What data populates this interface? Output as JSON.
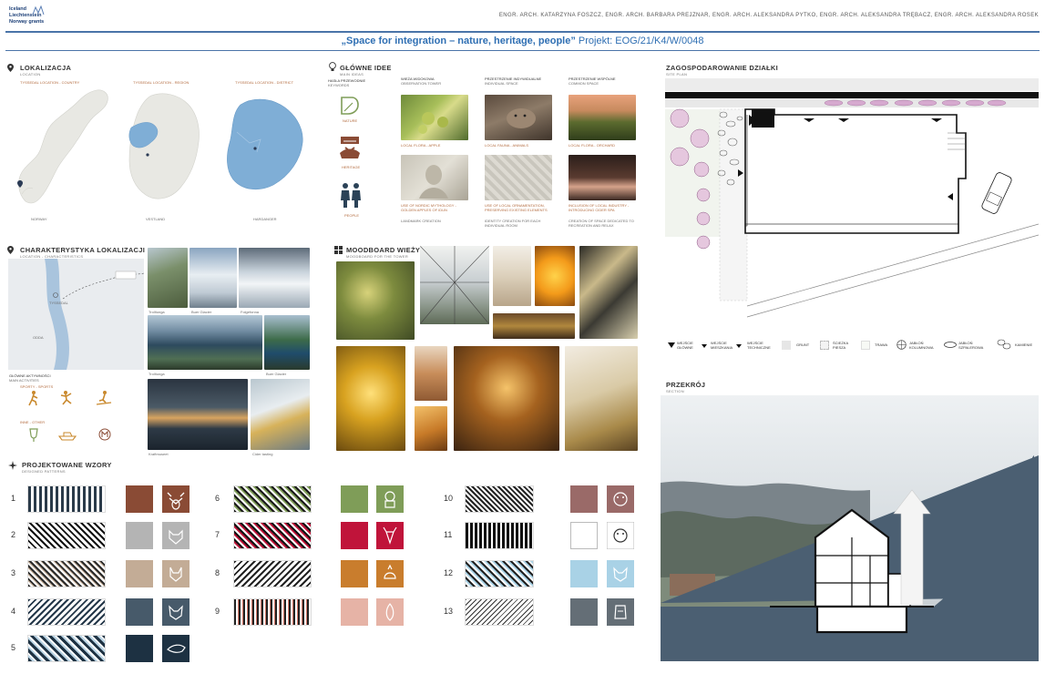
{
  "header": {
    "logo_lines": [
      "Iceland",
      "Liechtenstein",
      "Norway grants"
    ],
    "authors": "ENGR. ARCH. KATARZYNA FOSZCZ, ENGR. ARCH. BARBARA PREJZNAR, ENGR. ARCH. ALEKSANDRA PYTKO, ENGR. ARCH. ALEKSANDRA TRĘBACZ, ENGR. ARCH. ALEKSANDRA ROSEK",
    "title_quote": "„Space for integration – nature, heritage, people”",
    "title_project": " Projekt: EOG/21/K4/W/0048",
    "accent": "#2f6fb3",
    "rule_color": "#3f6fa8"
  },
  "location": {
    "title": "LOKALIZACJA",
    "subtitle": "LOCATION",
    "maps": [
      {
        "heading": "TYSSEDAL LOCATION - COUNTRY",
        "caption": "NORWAY"
      },
      {
        "heading": "TYSSEDAL LOCATION - REGION",
        "caption": "VESTLAND"
      },
      {
        "heading": "TYSSEDAL LOCATION - DISTRICT",
        "caption": "HARDANGER"
      }
    ]
  },
  "ideas": {
    "title": "GŁÓWNE IDEE",
    "subtitle": "MAIN IDEAS",
    "keywords_title": "HASŁA PRZEWODNIE",
    "keywords_sub": "KEYWORDS",
    "keywords": [
      "NATURE",
      "HERITAGE",
      "PEOPLE"
    ],
    "columns": [
      {
        "heading": "WIEŻA WIDOKOWA",
        "sub": "OBSERVATION TOWER",
        "cap1": "LOCAL FLORA - APPLE",
        "cap2": "USE OF NORDIC MYTHOLOGY - GOLDEN APPLES OF IDUN",
        "cap3": "LANDMARK CREATION"
      },
      {
        "heading": "PRZESTRZENIE INDYWIDUALNE",
        "sub": "INDIVIDUAL SPACE",
        "cap1": "LOCAL FAUNA - ANIMALS",
        "cap2": "USE OF LOCAL ORNAMENTATION, PRESERVING EXISTING ELEMENTS",
        "cap3": "IDENTITY CREATION FOR EACH INDIVIDUAL ROOM"
      },
      {
        "heading": "PRZESTRZENIE WSPÓLNE",
        "sub": "COMMON SPACE",
        "cap1": "LOCAL FLORA - ORCHARD",
        "cap2": "INCLUSION OF LOCAL INDUSTRY - INTRODUCING CIDER SPA",
        "cap3": "CREATION OF SPACE DEDICATED TO RECREATION AND RELAX"
      }
    ]
  },
  "site_plan": {
    "title": "ZAGOSPODAROWANIE DZIAŁKI",
    "subtitle": "SITE PLAN",
    "legend": [
      {
        "label": "WEJŚCIE GŁÓWNE"
      },
      {
        "label": "WEJŚCIE MIESZKANIA"
      },
      {
        "label": "WEJŚCIE TECHNICZNE"
      },
      {
        "label": "GRUNT"
      },
      {
        "label": "ŚCIEŻKA PIESZA"
      },
      {
        "label": "TRAWA"
      },
      {
        "label": "JABŁOŃ KOLUMNOWA"
      },
      {
        "label": "JABŁOŃ SZPALEROWA"
      },
      {
        "label": "KAMIENIE"
      }
    ]
  },
  "characteristics": {
    "title": "CHARAKTERYSTYKA LOKALIZACJI",
    "subtitle": "LOCATION - CHARACTERISTICS",
    "map_labels": [
      "TYSSEDAL",
      "ODDA"
    ],
    "activities_title": "GŁÓWNE AKTYWNOŚCI",
    "activities_sub": "MAIN ACTIVITIES",
    "sports_label": "SPORTY - SPORTS",
    "other_label": "INNE - OTHER",
    "photo_captions": [
      "Trolltunga",
      "Buer Glacier",
      "Folgefonna",
      "Trolltunga",
      "Buer Glacier",
      "Kraftmuseet",
      "Cider tasting"
    ]
  },
  "moodboard": {
    "title": "MOODBOARD WIEŻY",
    "subtitle": "MOODBOARD FOR THE TOWER"
  },
  "patterns": {
    "title": "PROJEKTOWANE WZORY",
    "subtitle": "DESIGNED PATTERNS",
    "rows": [
      {
        "n": "1",
        "color": "#8a4b35",
        "icon_color": "#8a4b35"
      },
      {
        "n": "2",
        "color": "#b4b4b4",
        "icon_color": "#b4b4b4"
      },
      {
        "n": "3",
        "color": "#c3ac96",
        "icon_color": "#c3ac96"
      },
      {
        "n": "4",
        "color": "#475a6a",
        "icon_color": "#475a6a"
      },
      {
        "n": "5",
        "color": "#1d3142",
        "icon_color": "#1d3142"
      },
      {
        "n": "6",
        "color": "#7f9d58",
        "icon_color": "#7f9d58"
      },
      {
        "n": "7",
        "color": "#c0143a",
        "icon_color": "#c0143a"
      },
      {
        "n": "8",
        "color": "#c97d2d",
        "icon_color": "#c97d2d"
      },
      {
        "n": "9",
        "color": "#e6b3a6",
        "icon_color": "#e6b3a6"
      },
      {
        "n": "10",
        "color": "#9a6a68",
        "icon_color": "#9a6a68"
      },
      {
        "n": "11",
        "color": "#ffffff",
        "icon_color": "#ffffff"
      },
      {
        "n": "12",
        "color": "#a9d2e6",
        "icon_color": "#a9d2e6"
      },
      {
        "n": "13",
        "color": "#646e76",
        "icon_color": "#646e76"
      }
    ]
  },
  "section": {
    "title": "PRZEKRÓJ",
    "subtitle": "SECTION"
  }
}
